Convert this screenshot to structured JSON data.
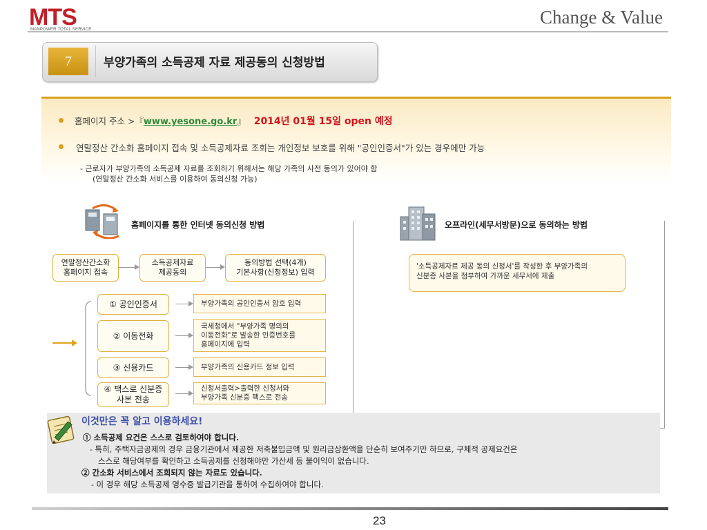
{
  "header": {
    "logo_text": "MTS",
    "logo_subtext": "MANPOWER TOTAL SERVICE",
    "slogan": "Change & Value"
  },
  "title": {
    "number": "7",
    "text": "부양가족의 소득공제 자료 제공동의 신청방법"
  },
  "info": {
    "line1_prefix": "홈페이지 주소 >『",
    "url": "www.yesone.go.kr",
    "line1_suffix": "』",
    "open_date": "2014년 01월 15일 open 예정",
    "line2": "연말정산 간소화 홈페이지 접속 및 소득공제자료 조회는 개인정보 보호를 위해 \"공인인증서\"가 있는 경우에만 가능",
    "sub1": "- 근로자가 부양가족의 소득공제 자료를 조회하기 위해서는 해당 가족의 사전 동의가 있어야 함",
    "sub2": "(연말정산 간소화 서비스를 이용하여 동의신청 가능)"
  },
  "online": {
    "title": "홈페이지를 통한 인터넷 동의신청 방법",
    "steps": [
      "연말정산간소화\n홈페이지 접속",
      "소득공제자료\n제공동의",
      "동의방법 선택(4개)\n기본사항(신청정보) 입력"
    ],
    "methods": [
      {
        "label": "① 공인인증서",
        "desc": "부양가족의 공인인증서 암호 입력"
      },
      {
        "label": "② 이동전화",
        "desc": "국세청에서 \"부양가족 명의의\n이동전화\"로 발송한 인증번호를\n홈페이지에 입력"
      },
      {
        "label": "③ 신용카드",
        "desc": "부양가족의 신용카드 정보 입력"
      },
      {
        "label": "④ 팩스로 신분증\n사본 전송",
        "desc": "신청서출력>출력한 신청서와\n부양가족 신분증 팩스로 전송"
      }
    ]
  },
  "offline": {
    "title": "오프라인(세무서방문)으로 동의하는 방법",
    "desc": "'소득공제자료 제공 동의 신청서'를 작성한 후 부양가족의\n신분증 사본을 첨부하여 가까운 세무서에 제출"
  },
  "note": {
    "title": "이것만은 꼭 알고 이용하세요!",
    "item1": "① 소득공제 요건은 스스로 검토하여야 합니다.",
    "item1_sub1": "- 특히, 주택자금공제의 경우 금융기관에서 제공한 저축불입금액 및 원리금상환액을 단순히 보여주기만 하므로, 구체적 공제요건은",
    "item1_sub2": "스스로 해당여부를 확인하고 소득공제를 신청해야만 가산세 등 불이익이 없습니다.",
    "item2": "② 간소화 서비스에서 조회되지 않는 자료도 있습니다.",
    "item2_sub": "- 이 경우 해당 소득공제 영수증 발급기관을 통하여 수집하여야 합니다."
  },
  "page_number": "23",
  "colors": {
    "brand_red": "#c0202a",
    "gold": "#d9a21c",
    "green_link": "#2a8a3a",
    "alert_red": "#d0141c",
    "note_blue": "#3d4fa8"
  }
}
